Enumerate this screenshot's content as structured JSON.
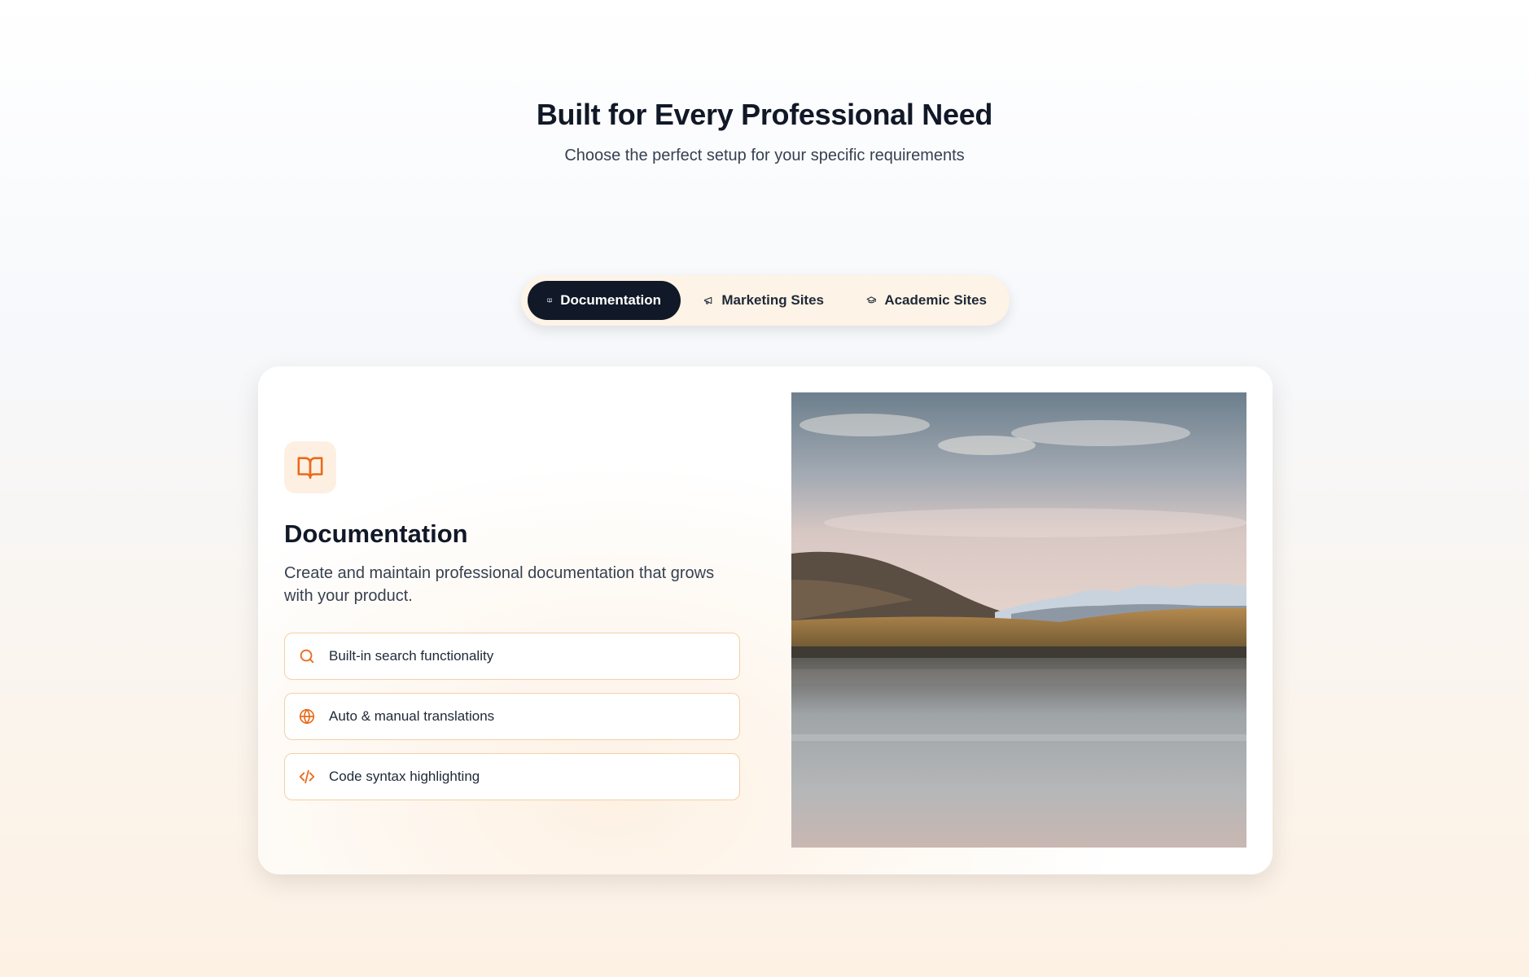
{
  "hero": {
    "title": "Built for Every Professional Need",
    "subtitle": "Choose the perfect setup for your specific requirements"
  },
  "tabs": [
    {
      "label": "Documentation",
      "icon": "book-icon",
      "active": true
    },
    {
      "label": "Marketing Sites",
      "icon": "megaphone-icon",
      "active": false
    },
    {
      "label": "Academic Sites",
      "icon": "graduation-cap-icon",
      "active": false
    }
  ],
  "card": {
    "icon": "book-icon",
    "title": "Documentation",
    "description": "Create and maintain professional documentation that grows with your product.",
    "features": [
      {
        "label": "Built-in search functionality",
        "icon": "search-icon"
      },
      {
        "label": "Auto & manual translations",
        "icon": "globe-icon"
      },
      {
        "label": "Code syntax highlighting",
        "icon": "code-icon"
      }
    ]
  },
  "colors": {
    "accent": "#ea6a1a",
    "active_tab": "#111827",
    "tab_bar_bg": "#fdf3e6",
    "feature_border": "#f6cfa6"
  }
}
